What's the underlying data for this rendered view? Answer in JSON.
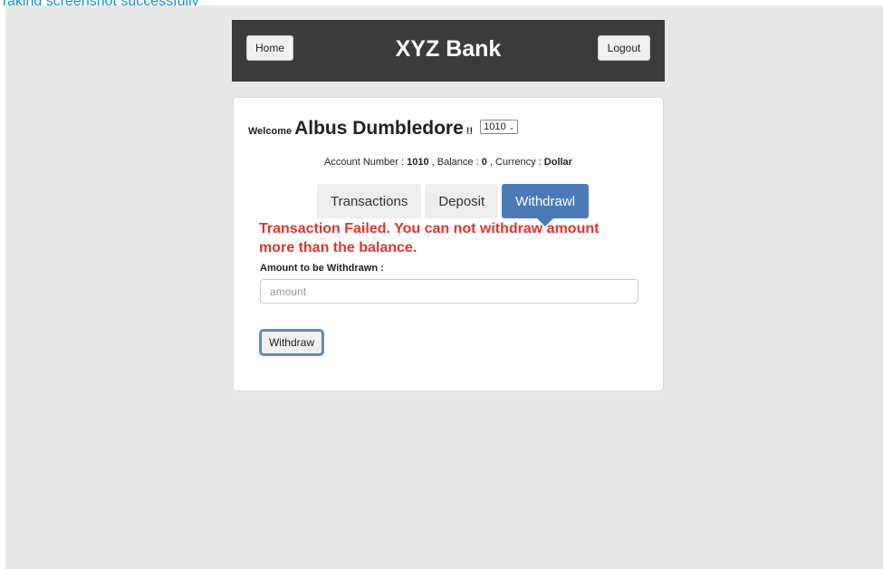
{
  "caption": "Taking screenshot successfully",
  "header": {
    "home_label": "Home",
    "title": "XYZ Bank",
    "logout_label": "Logout"
  },
  "welcome": {
    "prefix": "Welcome",
    "customer_name": "Albus Dumbledore",
    "suffix": "!!",
    "account_select_value": "1010"
  },
  "account_info": {
    "account_number_label": "Account Number : ",
    "account_number": "1010",
    "balance_label": " , Balance : ",
    "balance": "0",
    "currency_label": " , Currency : ",
    "currency": "Dollar"
  },
  "tabs": [
    {
      "label": "Transactions",
      "active": false
    },
    {
      "label": "Deposit",
      "active": false
    },
    {
      "label": "Withdrawl",
      "active": true
    }
  ],
  "withdraw_form": {
    "error_message": "Transaction Failed. You can not withdraw amount more than the balance.",
    "amount_label": "Amount to be Withdrawn :",
    "amount_placeholder": "amount",
    "amount_value": "",
    "submit_label": "Withdraw"
  },
  "colors": {
    "header_bg": "#3b3b3b",
    "page_bg": "#e8e8e8",
    "active_tab": "#4a7bb8",
    "error": "#e0342b",
    "caption": "#1a8fd8"
  }
}
